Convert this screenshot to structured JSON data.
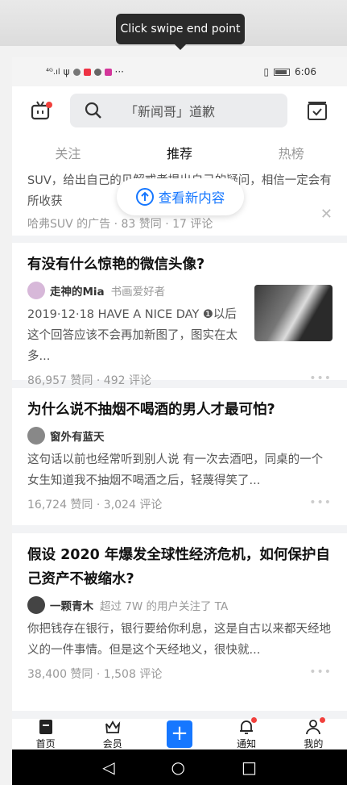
{
  "tooltip": "Click swipe end point",
  "status_bar": {
    "time": "6:06"
  },
  "header": {
    "search_placeholder": "「新闻哥」道歉"
  },
  "tabs": [
    {
      "label": "关注",
      "active": false
    },
    {
      "label": "推荐",
      "active": true
    },
    {
      "label": "热榜",
      "active": false
    }
  ],
  "new_content_button": "查看新内容",
  "ad": {
    "excerpt": "SUV，给出自己的见解或者提出自己的疑问，相信一定会有所收获",
    "meta": "哈弗SUV 的广告 · 83 赞同 · 17 评论"
  },
  "cards": [
    {
      "title": "有没有什么惊艳的微信头像?",
      "author": "走神的Mia",
      "author_desc": "书画爱好者",
      "excerpt": "2019·12·18 HAVE A NICE DAY ❶以后这个回答应该不会再加新图了，图实在太多...",
      "meta": "86,957 赞同 · 492 评论"
    },
    {
      "title": "为什么说不抽烟不喝酒的男人才最可怕?",
      "author": "窗外有蓝天",
      "author_desc": "",
      "excerpt": "这句话以前也经常听到别人说 有一次去酒吧，同桌的一个女生知道我不抽烟不喝酒之后，轻蔑得笑了...",
      "meta": "16,724 赞同 · 3,024 评论"
    },
    {
      "title": "假设 2020 年爆发全球性经济危机，如何保护自己资产不被缩水?",
      "author": "一颗青木",
      "author_desc": "超过 7W 的用户关注了 TA",
      "excerpt": "你把钱存在银行，银行要给你利息，这是自古以来都天经地义的一件事情。但是这个天经地义，很快就...",
      "meta": "38,400 赞同 · 1,508 评论"
    }
  ],
  "bottom_nav": [
    {
      "label": "首页",
      "icon": "home-icon"
    },
    {
      "label": "会员",
      "icon": "crown-icon"
    },
    {
      "label": "",
      "icon": "plus-icon"
    },
    {
      "label": "通知",
      "icon": "bell-icon"
    },
    {
      "label": "我的",
      "icon": "profile-icon"
    }
  ],
  "colors": {
    "accent": "#1677ff",
    "badge": "#f1403c"
  }
}
